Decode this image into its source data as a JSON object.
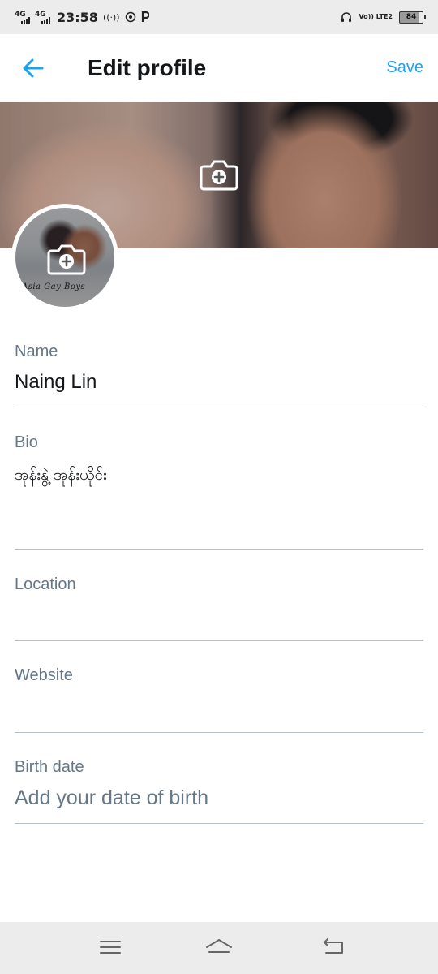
{
  "status_bar": {
    "network_1": "4G",
    "network_2": "4G",
    "time": "23:58",
    "volte": "Vo)) LTE2",
    "battery": "84",
    "battery_level_percent": 84
  },
  "header": {
    "back_icon": "arrow-left-icon",
    "title": "Edit profile",
    "save_label": "Save"
  },
  "banner": {
    "camera_icon": "add-photo-icon"
  },
  "avatar": {
    "caption": "Asia Gay Boys",
    "camera_icon": "add-photo-icon"
  },
  "form": {
    "name": {
      "label": "Name",
      "value": "Naing Lin"
    },
    "bio": {
      "label": "Bio",
      "value": "အုန်းနွဲ့ အုန်းယိုင်း"
    },
    "location": {
      "label": "Location",
      "value": ""
    },
    "website": {
      "label": "Website",
      "value": ""
    },
    "birth_date": {
      "label": "Birth date",
      "placeholder": "Add your date of birth"
    }
  },
  "nav_bar": {
    "icons": [
      "menu-icon",
      "home-icon",
      "back-icon"
    ]
  },
  "colors": {
    "accent": "#1da1f2",
    "label": "#657786",
    "divider": "#b8c3cc"
  }
}
